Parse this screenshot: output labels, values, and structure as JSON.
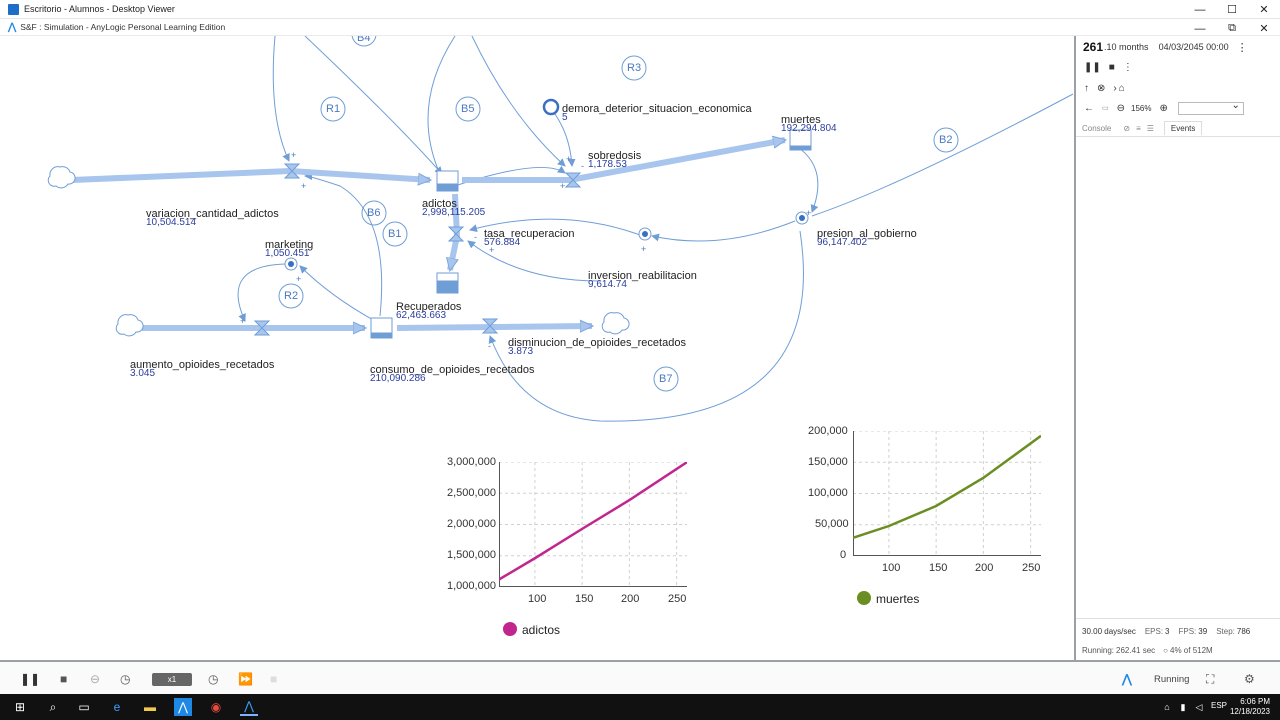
{
  "outer_window": {
    "title": "Escritorio - Alumnos - Desktop Viewer",
    "controls": [
      "—",
      "☐",
      "✕"
    ]
  },
  "inner_window": {
    "title": "S&F : Simulation - AnyLogic Personal Learning Edition",
    "controls": [
      "—",
      "⧉",
      "✕"
    ]
  },
  "model": {
    "loops": [
      "B4",
      "R1",
      "B5",
      "R3",
      "B2",
      "B6",
      "B1",
      "R2",
      "B7"
    ],
    "stocks": [
      {
        "name": "adictos",
        "value": "2,998,115.205"
      },
      {
        "name": "muertes",
        "value": "192,294.804"
      },
      {
        "name": "Recuperados",
        "value": "62,463.663"
      },
      {
        "name": "consumo_de_opioides_recetados",
        "value": "210,090.286"
      }
    ],
    "flows": [
      {
        "name": "variacion_cantidad_adictos",
        "value": "10,504.514"
      },
      {
        "name": "sobredosis",
        "value": "1,178.53"
      },
      {
        "name": "tasa_recuperacion",
        "value": "576.884"
      },
      {
        "name": "aumento_opioides_recetados",
        "value": "3.045"
      },
      {
        "name": "disminucion_de_opioides_recetados",
        "value": "3.873"
      }
    ],
    "variables": [
      {
        "name": "marketing",
        "value": "1,050.451"
      },
      {
        "name": "presion_al_gobierno",
        "value": "96,147.402"
      },
      {
        "name": "inversion_reabilitacion",
        "value": "9,614.74"
      },
      {
        "name": "demora_deterior_situacion_economica",
        "value": "5"
      }
    ],
    "signs": {
      "plus": "+",
      "minus": "-"
    }
  },
  "chart_data": [
    {
      "type": "line",
      "title": "",
      "xlabel": "",
      "ylabel": "",
      "x_ticks": [
        "100",
        "150",
        "200",
        "250"
      ],
      "y_ticks": [
        "1,000,000",
        "1,500,000",
        "2,000,000",
        "2,500,000",
        "3,000,000"
      ],
      "xlim": [
        62,
        261
      ],
      "ylim": [
        1000000,
        3000000
      ],
      "grid": true,
      "legend": "bottom",
      "series": [
        {
          "name": "adictos",
          "color": "#c0268e",
          "x": [
            62,
            100,
            150,
            200,
            261
          ],
          "y": [
            1120000,
            1460000,
            1930000,
            2390000,
            2998115
          ]
        }
      ]
    },
    {
      "type": "line",
      "title": "",
      "xlabel": "",
      "ylabel": "",
      "x_ticks": [
        "100",
        "150",
        "200",
        "250"
      ],
      "y_ticks": [
        "0",
        "50,000",
        "100,000",
        "150,000",
        "200,000"
      ],
      "xlim": [
        62,
        261
      ],
      "ylim": [
        0,
        200000
      ],
      "grid": true,
      "legend": "bottom",
      "series": [
        {
          "name": "muertes",
          "color": "#6b8e23",
          "x": [
            62,
            100,
            150,
            200,
            261
          ],
          "y": [
            29000,
            48000,
            80000,
            125000,
            192295
          ]
        }
      ]
    }
  ],
  "right_panel": {
    "time_big": "261",
    "time_unit": ".10 months",
    "date": "04/03/2045 00:00",
    "kebab": "⋮",
    "zoom": "156%",
    "tabs": {
      "console": "Console",
      "events": "Events"
    },
    "stats": {
      "speed": "30.00 days/sec",
      "eps_label": "EPS:",
      "eps": "3",
      "fps_label": "FPS:",
      "fps": "39",
      "step_label": "Step:",
      "step": "786",
      "running_label": "Running:",
      "running": "262.41 sec",
      "memory": "4% of 512M"
    }
  },
  "bottom_bar": {
    "speed": "x1",
    "status": "Running"
  },
  "taskbar": {
    "lang": "ESP",
    "time": "6:06 PM",
    "date": "12/18/2023"
  }
}
